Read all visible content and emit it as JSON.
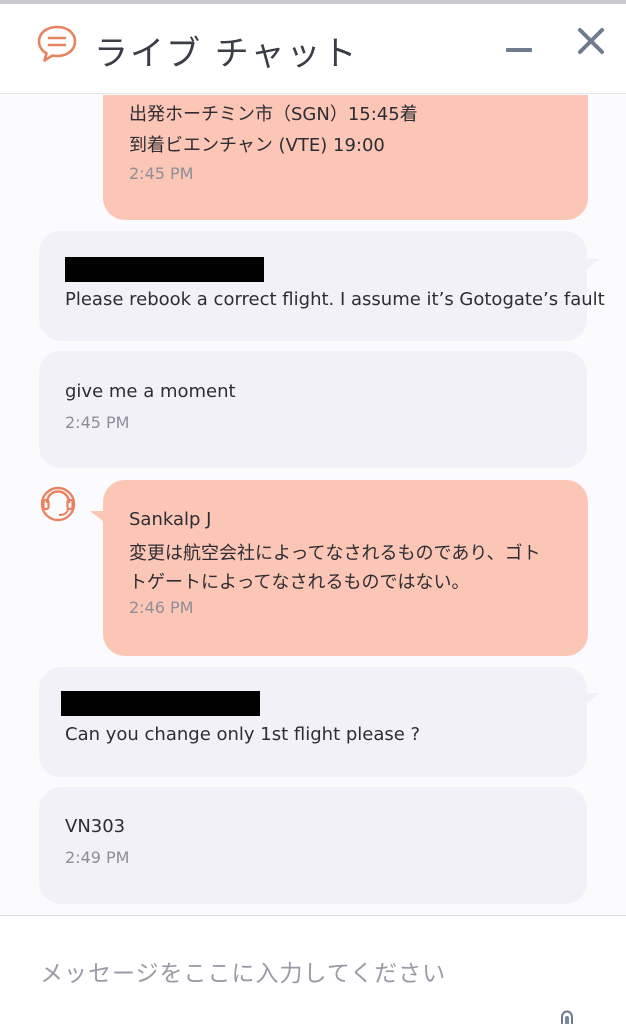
{
  "header": {
    "title": "ライブ チャット",
    "logo_icon": "chat-bubble-icon",
    "minimize_icon": "minimize-icon",
    "close_icon": "close-icon"
  },
  "messages": [
    {
      "role": "agent",
      "lines": [
        "出発ホーチミン市（SGN）15:45着",
        "到着ビエンチャン (VTE) 19:00"
      ],
      "time": "2:45 PM"
    },
    {
      "role": "user",
      "sender_redacted": true,
      "lines": [
        "Please rebook a correct flight. I assume it’s Gotogate’s fault"
      ]
    },
    {
      "role": "user",
      "lines": [
        "give me a moment"
      ],
      "time": "2:45 PM"
    },
    {
      "role": "agent",
      "sender": "Sankalp J",
      "lines": [
        "変更は航空会社によってなされるものであり、ゴト",
        "トゲートによってなされるものではない。"
      ],
      "time": "2:46 PM"
    },
    {
      "role": "user",
      "sender_redacted": true,
      "lines": [
        "Can you change only 1st flight please ?"
      ]
    },
    {
      "role": "user",
      "lines": [
        "VN303"
      ],
      "time": "2:49 PM"
    }
  ],
  "input": {
    "placeholder": "メッセージをここに入力してください",
    "value": ""
  },
  "colors": {
    "agent_bubble": "#fcc6b6",
    "user_bubble": "#f1f1f7",
    "accent": "#e8825f",
    "header_icons": "#6f7c8f"
  }
}
